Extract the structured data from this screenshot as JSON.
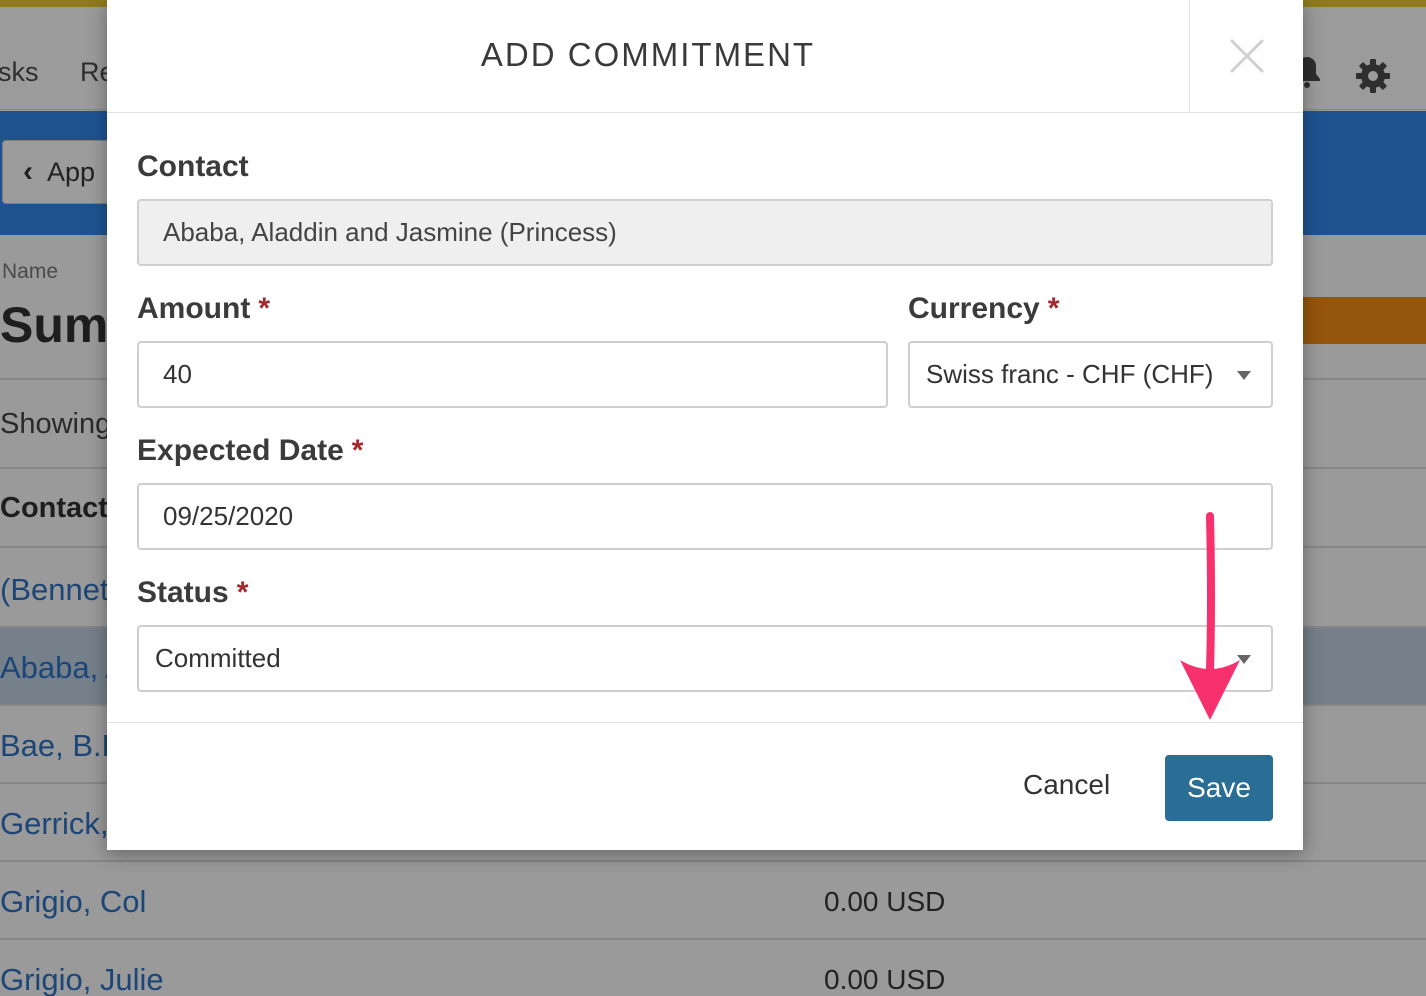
{
  "background": {
    "nav_items": [
      "sks",
      "Re"
    ],
    "back_button_label": "App",
    "name_label": "Name",
    "page_title": "Sum",
    "showing_text": "Showing",
    "column_header": "Contact",
    "rows": [
      {
        "name": "(Bennet",
        "amount": ""
      },
      {
        "name": "Ababa, A",
        "amount": "",
        "selected": true
      },
      {
        "name": "Bae, B.E",
        "amount": ""
      },
      {
        "name": "Gerrick,",
        "amount": ""
      },
      {
        "name": "Grigio, Col",
        "amount": "0.00 USD"
      },
      {
        "name": "Grigio, Julie",
        "amount": "0.00 USD"
      }
    ]
  },
  "modal": {
    "title": "ADD COMMITMENT",
    "contact": {
      "label": "Contact",
      "value": "Ababa, Aladdin and Jasmine (Princess)"
    },
    "amount": {
      "label": "Amount",
      "value": "40"
    },
    "currency": {
      "label": "Currency",
      "value": "Swiss franc - CHF (CHF)"
    },
    "expected_date": {
      "label": "Expected Date",
      "value": "09/25/2020"
    },
    "status": {
      "label": "Status",
      "value": "Committed"
    },
    "required_mark": "*",
    "cancel_label": "Cancel",
    "save_label": "Save"
  },
  "colors": {
    "save_button": "#2a6d95",
    "required": "#a5282c",
    "annotation_arrow": "#f7306e"
  },
  "icons": [
    "close-icon",
    "bell-icon",
    "gear-icon",
    "chevron-left-icon",
    "dropdown-caret-icon",
    "annotation-arrow"
  ]
}
